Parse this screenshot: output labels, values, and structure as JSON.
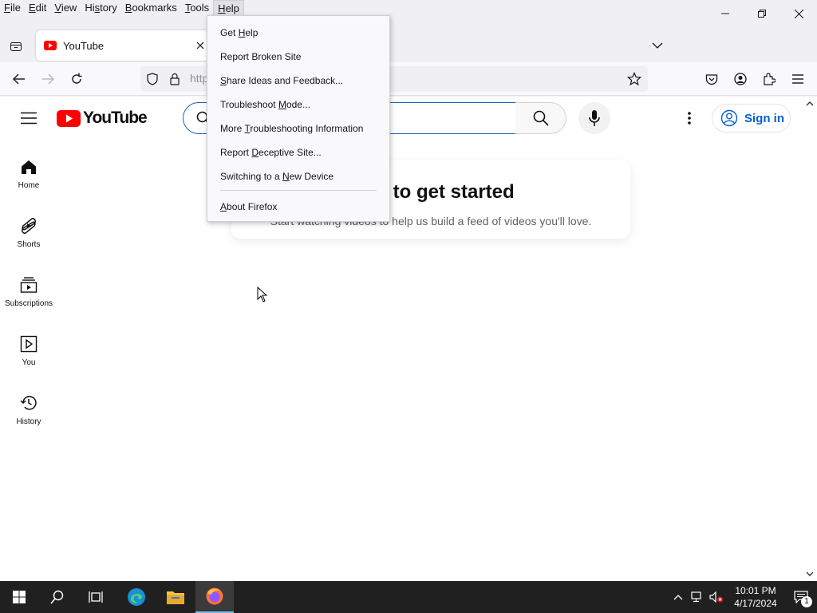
{
  "menubar": {
    "items": [
      {
        "label": "File",
        "u": "F",
        "rest": "ile"
      },
      {
        "label": "Edit",
        "u": "E",
        "rest": "dit"
      },
      {
        "label": "View",
        "u": "V",
        "rest": "iew"
      },
      {
        "label": "History",
        "u": "H",
        "rest": "istory",
        "pre": ""
      },
      {
        "label": "Bookmarks",
        "u": "B",
        "rest": "ookmarks"
      },
      {
        "label": "Tools",
        "u": "T",
        "rest": "ools"
      },
      {
        "label": "Help",
        "u": "H",
        "rest": "elp"
      }
    ],
    "active": "Help"
  },
  "tab": {
    "title": "YouTube"
  },
  "urlbar": {
    "text": "http"
  },
  "youtube": {
    "logo_text": "YouTube",
    "signin_label": "Sign in",
    "sidebar": [
      {
        "label": "Home",
        "icon": "home-icon"
      },
      {
        "label": "Shorts",
        "icon": "shorts-icon"
      },
      {
        "label": "Subscriptions",
        "icon": "subscriptions-icon"
      },
      {
        "label": "You",
        "icon": "you-icon"
      },
      {
        "label": "History",
        "icon": "history-icon"
      }
    ],
    "card_title": "hing to get started",
    "card_subtitle": "Start watching videos to help us build a feed of videos you'll love."
  },
  "help_menu": {
    "items": [
      {
        "pre": "Get ",
        "u": "H",
        "post": "elp"
      },
      {
        "pre": "Report Broken Site",
        "u": "",
        "post": ""
      },
      {
        "pre": "",
        "u": "S",
        "post": "hare Ideas and Feedback..."
      },
      {
        "pre": "Troubleshoot ",
        "u": "M",
        "post": "ode..."
      },
      {
        "pre": "More ",
        "u": "T",
        "post": "roubleshooting Information"
      },
      {
        "pre": "Report ",
        "u": "D",
        "post": "eceptive Site..."
      },
      {
        "pre": "Switching to a ",
        "u": "N",
        "post": "ew Device"
      },
      {
        "pre": "",
        "u": "A",
        "post": "bout Firefox"
      }
    ]
  },
  "taskbar": {
    "time": "10:01 PM",
    "date": "4/17/2024",
    "notification_count": "1"
  },
  "colors": {
    "youtube_red": "#ff0000",
    "link_blue": "#065fd4",
    "taskbar_bg": "#202020"
  }
}
